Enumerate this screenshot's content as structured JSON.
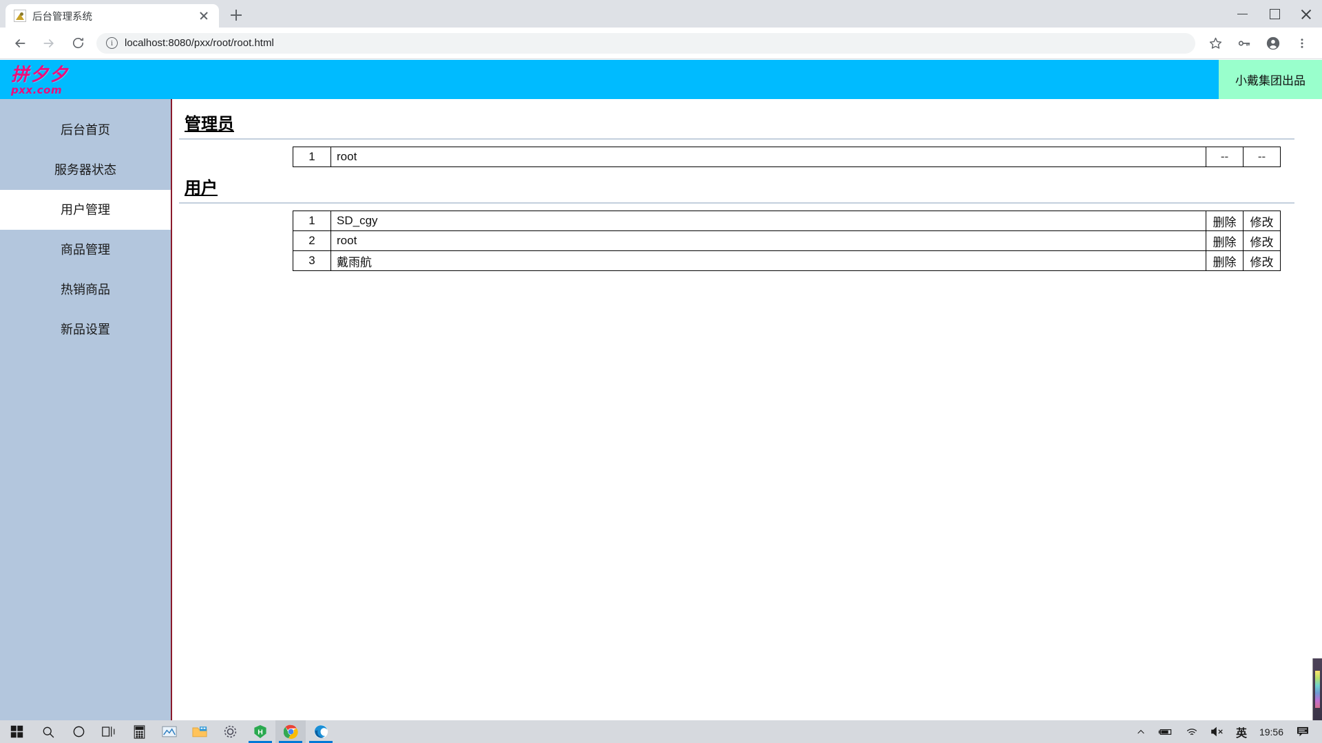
{
  "browser": {
    "tab": {
      "title": "后台管理系统",
      "favicon": "image-favicon"
    },
    "new_tab_label": "+",
    "window_controls": {
      "minimize": "minimize-icon",
      "maximize": "maximize-icon",
      "close": "close-icon"
    },
    "nav": {
      "back": "back-arrow-icon",
      "forward": "forward-arrow-icon",
      "reload": "reload-icon"
    },
    "omnibox": {
      "info": "info-circle-icon",
      "url": "localhost:8080/pxx/root/root.html"
    },
    "actions": {
      "bookmark": "star-icon",
      "passwords": "key-icon",
      "profile": "avatar-icon",
      "menu": "three-dot-menu-icon"
    }
  },
  "site": {
    "logo_cn": "拼夕夕",
    "logo_en": "pxx.com",
    "badge": "小戴集团出品",
    "header_color": "#00bbff",
    "badge_color": "#99ffcc"
  },
  "sidebar": {
    "items": [
      {
        "label": "后台首页",
        "active": false
      },
      {
        "label": "服务器状态",
        "active": false
      },
      {
        "label": "用户管理",
        "active": true
      },
      {
        "label": "商品管理",
        "active": false
      },
      {
        "label": "热销商品",
        "active": false
      },
      {
        "label": "新品设置",
        "active": false
      }
    ]
  },
  "main": {
    "admin_section": {
      "title": "管理员",
      "rows": [
        {
          "index": "1",
          "name": "root",
          "action1": "--",
          "action2": "--"
        }
      ]
    },
    "user_section": {
      "title": "用户",
      "rows": [
        {
          "index": "1",
          "name": "SD_cgy",
          "action1": "删除",
          "action2": "修改"
        },
        {
          "index": "2",
          "name": "root",
          "action1": "删除",
          "action2": "修改"
        },
        {
          "index": "3",
          "name": "戴雨航",
          "action1": "删除",
          "action2": "修改"
        }
      ]
    }
  },
  "taskbar": {
    "start": "windows-start-icon",
    "items": [
      "search-icon",
      "cortana-icon",
      "task-view-icon",
      "calculator-icon",
      "photos-icon",
      "file-explorer-icon",
      "settings-icon",
      "hbuilder-icon",
      "chrome-icon",
      "edge-icon"
    ],
    "tray": {
      "overflow": "chevron-up-icon",
      "battery": "battery-icon",
      "network": "wifi-icon",
      "volume": "speaker-muted-icon",
      "ime": "英",
      "clock": "19:56",
      "notifications": "notification-icon"
    }
  }
}
